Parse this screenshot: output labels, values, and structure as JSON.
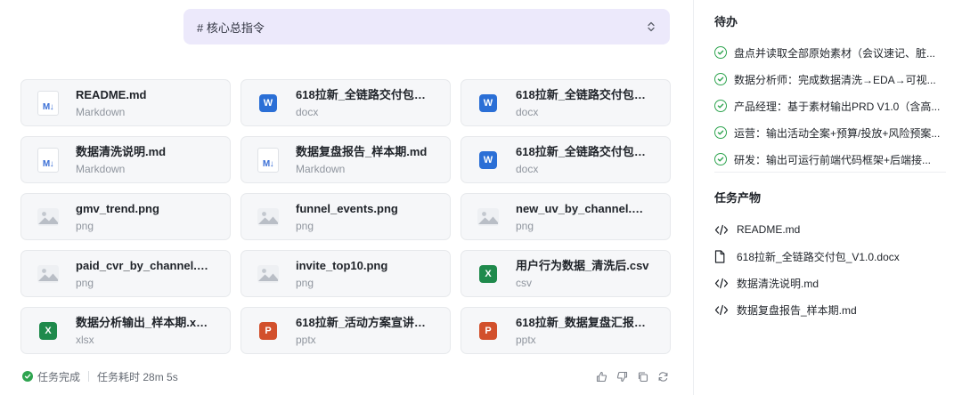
{
  "instruction": {
    "text": "# 核心总指令"
  },
  "files": [
    {
      "name": "README.md",
      "type": "Markdown",
      "icon": "markdown-icon"
    },
    {
      "name": "618拉新_全链路交付包_V...",
      "type": "docx",
      "icon": "word-icon"
    },
    {
      "name": "618拉新_全链路交付包_V...",
      "type": "docx",
      "icon": "word-icon"
    },
    {
      "name": "数据清洗说明.md",
      "type": "Markdown",
      "icon": "markdown-icon"
    },
    {
      "name": "数据复盘报告_样本期.md",
      "type": "Markdown",
      "icon": "markdown-icon"
    },
    {
      "name": "618拉新_全链路交付包_V...",
      "type": "docx",
      "icon": "word-icon"
    },
    {
      "name": "gmv_trend.png",
      "type": "png",
      "icon": "image-icon"
    },
    {
      "name": "funnel_events.png",
      "type": "png",
      "icon": "image-icon"
    },
    {
      "name": "new_uv_by_channel.png",
      "type": "png",
      "icon": "image-icon"
    },
    {
      "name": "paid_cvr_by_channel.png",
      "type": "png",
      "icon": "image-icon"
    },
    {
      "name": "invite_top10.png",
      "type": "png",
      "icon": "image-icon"
    },
    {
      "name": "用户行为数据_清洗后.csv",
      "type": "csv",
      "icon": "excel-icon"
    },
    {
      "name": "数据分析输出_样本期.xlsx",
      "type": "xlsx",
      "icon": "excel-icon"
    },
    {
      "name": "618拉新_活动方案宣讲PP...",
      "type": "pptx",
      "icon": "powerpoint-icon"
    },
    {
      "name": "618拉新_数据复盘汇报PP...",
      "type": "pptx",
      "icon": "powerpoint-icon"
    }
  ],
  "footer": {
    "status": "任务完成",
    "duration": "任务耗时 28m 5s"
  },
  "sidebar": {
    "todo_title": "待办",
    "todos": [
      "盘点并读取全部原始素材（会议速记、脏...",
      "数据分析师：完成数据清洗→EDA→可视...",
      "产品经理：基于素材输出PRD V1.0（含高...",
      "运营：输出活动全案+预算/投放+风险预案...",
      "研发：输出可运行前端代码框架+后端接..."
    ],
    "outputs_title": "任务产物",
    "outputs": [
      {
        "name": "README.md",
        "icon": "code-icon"
      },
      {
        "name": "618拉新_全链路交付包_V1.0.docx",
        "icon": "document-icon"
      },
      {
        "name": "数据清洗说明.md",
        "icon": "code-icon"
      },
      {
        "name": "数据复盘报告_样本期.md",
        "icon": "code-icon"
      }
    ]
  },
  "colors": {
    "word": "#2b6fd6",
    "excel": "#1f8a4c",
    "powerpoint": "#d2502c",
    "success": "#2ea44f",
    "instruction_bg": "#ece9fb"
  }
}
